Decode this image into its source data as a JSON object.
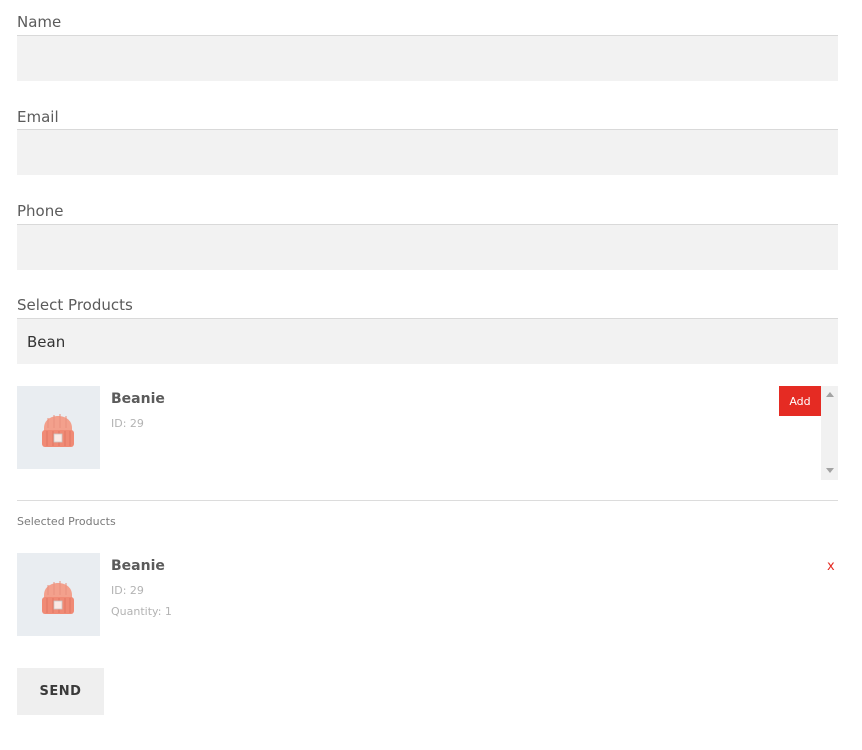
{
  "form": {
    "fields": [
      {
        "label": "Name",
        "value": ""
      },
      {
        "label": "Email",
        "value": ""
      },
      {
        "label": "Phone",
        "value": ""
      }
    ],
    "products_label": "Select Products",
    "products_search_value": "Bean"
  },
  "results": [
    {
      "name": "Beanie",
      "id_text": "ID: 29",
      "action_label": "Add",
      "icon": "beanie-icon"
    }
  ],
  "selected": {
    "title": "Selected Products",
    "items": [
      {
        "name": "Beanie",
        "id_text": "ID: 29",
        "quantity_text": "Quantity: 1",
        "remove_label": "x",
        "icon": "beanie-icon"
      }
    ]
  },
  "actions": {
    "send_label": "SEND"
  },
  "colors": {
    "accent": "#e52b23",
    "input_bg": "#f2f2f2",
    "thumb_bg": "#e9edf1",
    "beanie": "#f08a75"
  }
}
